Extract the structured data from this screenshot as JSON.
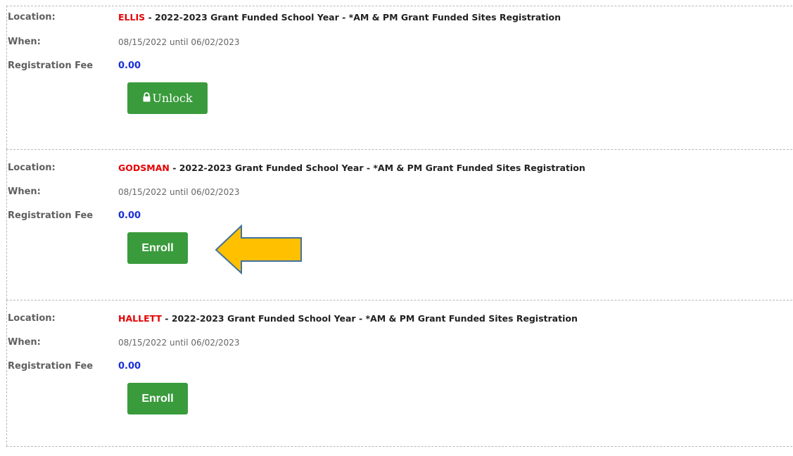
{
  "labels": {
    "location": "Location:",
    "when": "When:",
    "fee": "Registration Fee"
  },
  "entries": [
    {
      "location_name": "ELLIS",
      "location_rest": " - 2022-2023 Grant Funded School Year - *AM & PM Grant Funded Sites Registration",
      "when": "08/15/2022 until 06/02/2023",
      "fee": "0.00",
      "button_label": "Unlock",
      "button_icon": "lock-icon"
    },
    {
      "location_name": "GODSMAN",
      "location_rest": " - 2022-2023 Grant Funded School Year - *AM & PM Grant Funded Sites Registration",
      "when": "08/15/2022 until 06/02/2023",
      "fee": "0.00",
      "button_label": "Enroll"
    },
    {
      "location_name": "HALLETT",
      "location_rest": " - 2022-2023 Grant Funded School Year - *AM & PM Grant Funded Sites Registration",
      "when": "08/15/2022 until 06/02/2023",
      "fee": "0.00",
      "button_label": "Enroll"
    }
  ],
  "colors": {
    "location_name": "#e40000",
    "fee": "#1a2fd6",
    "button": "#3a9b3c",
    "arrow_fill": "#ffc000",
    "arrow_stroke": "#41719c"
  }
}
